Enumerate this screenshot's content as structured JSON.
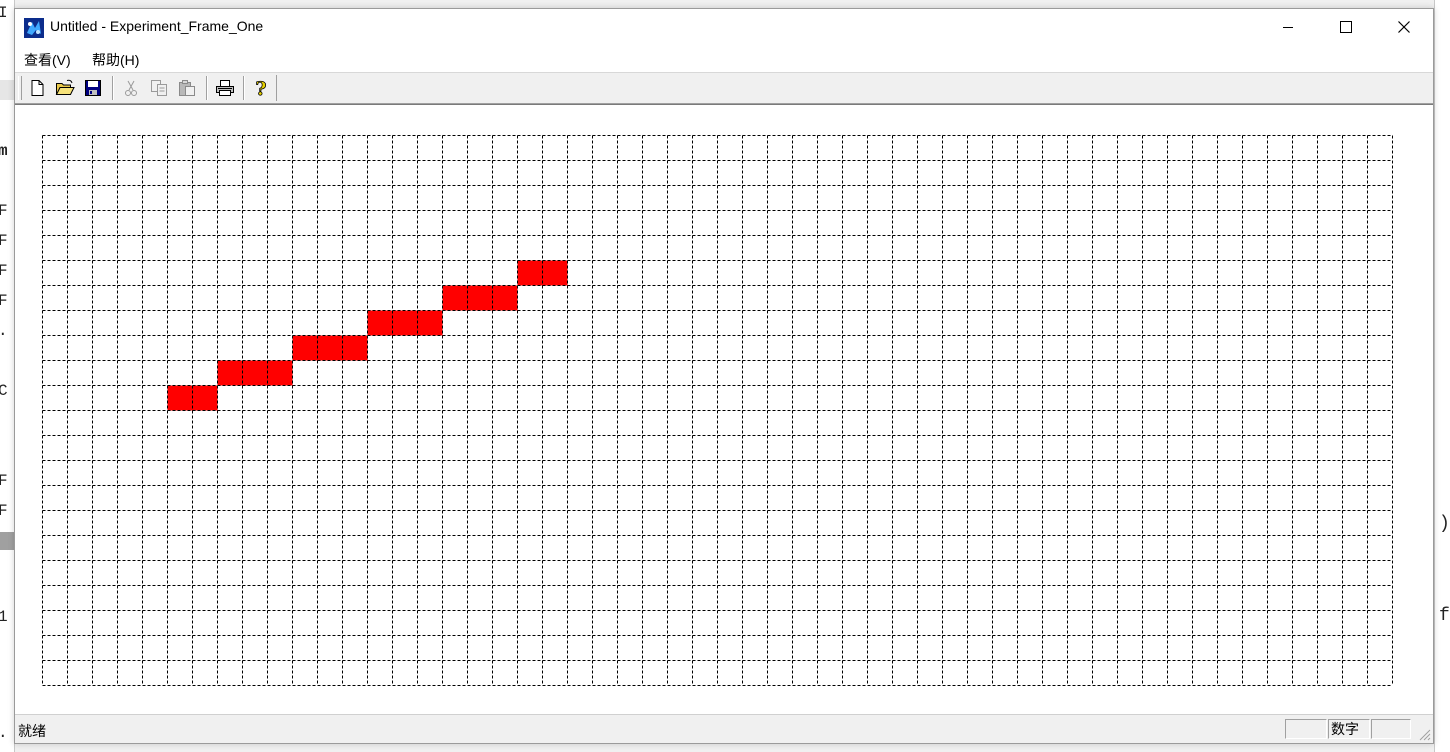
{
  "window": {
    "title": "Untitled - Experiment_Frame_One"
  },
  "menu": {
    "items": [
      "查看(V)",
      "帮助(H)"
    ]
  },
  "toolbar": {
    "buttons": [
      {
        "icon": "new-document-icon",
        "enabled": true
      },
      {
        "icon": "open-folder-icon",
        "enabled": true
      },
      {
        "icon": "save-disk-icon",
        "enabled": true
      },
      {
        "icon": "cut-scissors-icon",
        "enabled": false
      },
      {
        "icon": "copy-icon",
        "enabled": false
      },
      {
        "icon": "paste-icon",
        "enabled": false
      },
      {
        "icon": "print-icon",
        "enabled": true
      },
      {
        "icon": "help-question-icon",
        "enabled": true
      }
    ]
  },
  "canvas": {
    "grid_columns": 54,
    "grid_rows": 22,
    "filled_color": "#ff0000",
    "grid_line_color": "#000000",
    "filled_cells": [
      [
        5,
        10
      ],
      [
        6,
        10
      ],
      [
        7,
        9
      ],
      [
        8,
        9
      ],
      [
        9,
        9
      ],
      [
        10,
        8
      ],
      [
        11,
        8
      ],
      [
        12,
        8
      ],
      [
        13,
        7
      ],
      [
        14,
        7
      ],
      [
        15,
        7
      ],
      [
        16,
        6
      ],
      [
        17,
        6
      ],
      [
        18,
        6
      ],
      [
        19,
        5
      ],
      [
        20,
        5
      ]
    ]
  },
  "status": {
    "text": "就绪",
    "indicator_num": "数字"
  },
  "background": {
    "left_chars": [
      "I",
      "m",
      "F",
      "F",
      "F",
      "F",
      ".",
      "C",
      "F",
      "F",
      "1",
      "."
    ],
    "right_chars": [
      ")",
      "f"
    ]
  }
}
